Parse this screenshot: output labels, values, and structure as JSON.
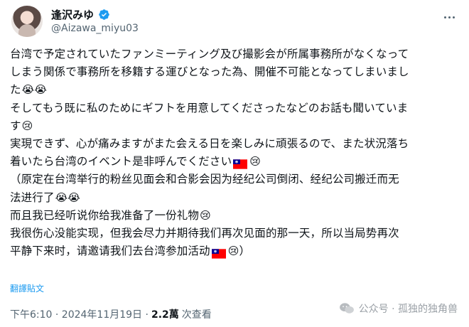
{
  "author": {
    "display_name": "逢沢みゆ",
    "handle": "@Aizawa_miyu03"
  },
  "tweet": {
    "lines": [
      {
        "text": "台湾で予定されていたファンミーティング及び撮影会が所属事務所がなくなって"
      },
      {
        "text": "しまう関係で事務所を移籍する運びとなった為、開催不可能となってしまいまし"
      },
      {
        "text": "た",
        "emoji": "😭😭"
      },
      {
        "text": "そしてもう既に私のためにギフトを用意してくださったなどのお話も聞いていま"
      },
      {
        "text": "す",
        "emoji": "😢"
      },
      {
        "text": "実現できず、心が痛みますがまた会える日を楽しみに頑張るので、また状況落ち"
      },
      {
        "text": "着いたら台湾のイベント是非呼んでください",
        "flag": true,
        "emoji": "😢"
      },
      {
        "text": "（原定在台湾举行的粉丝见面会和合影会因为经纪公司倒闭、经纪公司搬迁而无"
      },
      {
        "text": "法进行了",
        "emoji": "😭😭"
      },
      {
        "text": "而且我已经听说你给我准备了一份礼物",
        "emoji": "😢"
      },
      {
        "text": "我很伤心没能实现，但我会尽力并期待我们再次见面的那一天，所以当局势再次"
      },
      {
        "text": "平静下来时，请邀请我们去台湾参加活动",
        "flag": true,
        "emoji": "😢",
        "suffix": "）"
      }
    ],
    "translate_label": "翻譯貼文",
    "timestamp": "下午6:10 · 2024年11月19日 ·",
    "views_count": "2.2萬",
    "views_label": "次查看"
  },
  "watermark": {
    "text": "公众号 · 孤独的独角兽"
  },
  "icons": {
    "verified": "verified-badge-icon",
    "more": "more-options-icon",
    "flag": "taiwan-flag-icon",
    "watermark": "wechat-icon"
  },
  "colors": {
    "accent": "#1d9bf0",
    "text": "#0f1419",
    "secondary": "#536471"
  }
}
